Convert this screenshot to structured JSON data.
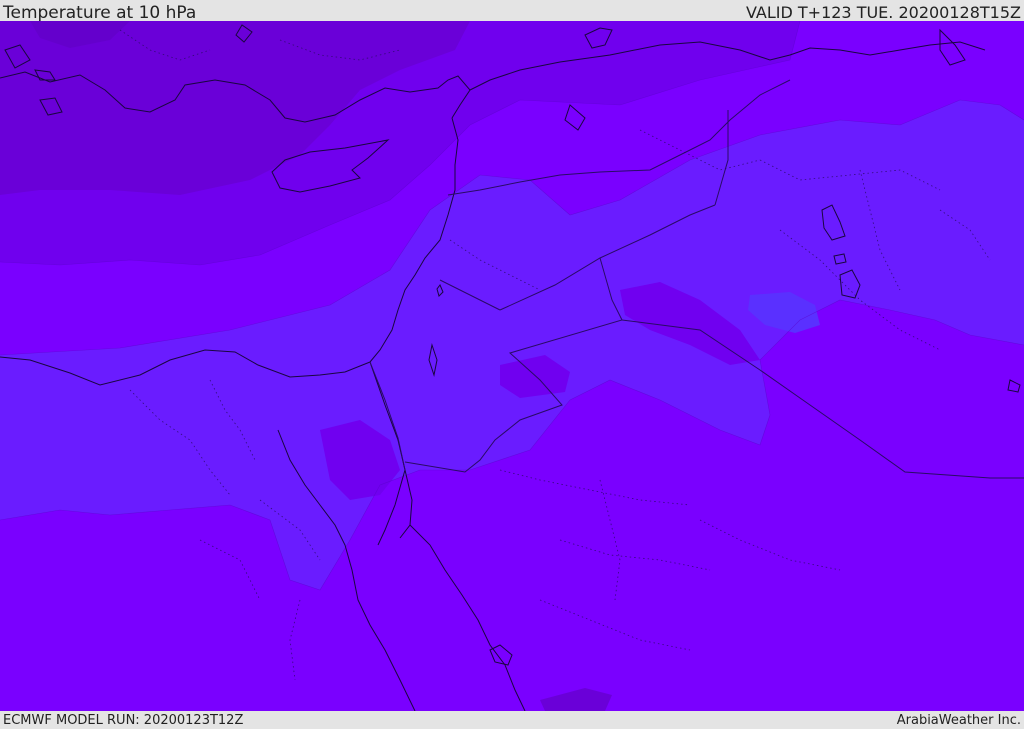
{
  "header": {
    "title": "Temperature at 10 hPa",
    "valid": "VALID T+123 TUE. 20200128T15Z"
  },
  "footer": {
    "model_run": "ECMWF MODEL RUN: 20200123T12Z",
    "credit": "ArabiaWeather Inc."
  },
  "colors": {
    "base": "#7a00ff",
    "warm_band": "#7000ee",
    "warmest": "#6a00d8",
    "cool_band": "#6a1cff",
    "coolest": "#5a30ff",
    "coastline": "#1a0640",
    "borders": "#2a0a66"
  }
}
